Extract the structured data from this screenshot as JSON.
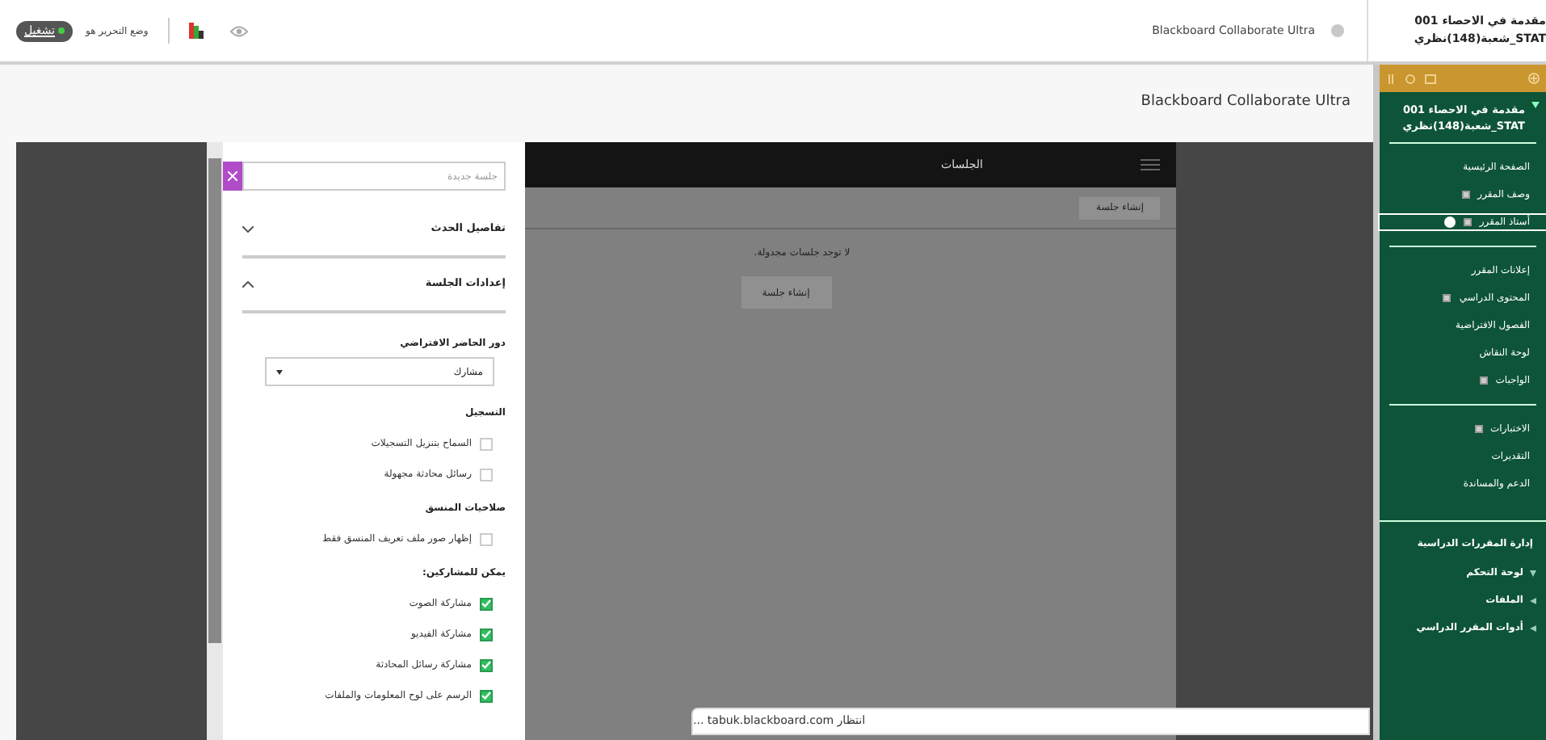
{
  "top_bar": {
    "edit_mode_label": "وضع التحرير هو",
    "edit_mode_toggle": {
      "label": "تشغيل",
      "on": true
    },
    "tool_name": "Blackboard Collaborate Ultra",
    "course_title": [
      "مقدمة في الاحصاء 001",
      "STAT_شعبة(148)نظري"
    ]
  },
  "page_title": "Blackboard Collaborate Ultra",
  "session_panel": {
    "search": {
      "placeholder": "جلسة جديدة"
    },
    "sections": [
      {
        "title": "تفاصيل الحدث",
        "expanded": false
      },
      {
        "title": "إعدادات الجلسة",
        "expanded": true
      }
    ],
    "role_label": "دور الحاضر الافتراضي",
    "role_value": "مشارك",
    "groups": [
      {
        "title": "التسجيل",
        "options": [
          {
            "label": "السماح بتنزيل التسجيلات",
            "checked": false
          },
          {
            "label": "رسائل محادثة مجهولة",
            "checked": false
          }
        ]
      },
      {
        "title": "صلاحيات المنسق",
        "options": [
          {
            "label": "إظهار صور ملف تعريف المنسق فقط",
            "checked": false
          }
        ]
      },
      {
        "title": "يمكن للمشاركين:",
        "options": [
          {
            "label": "مشاركة الصوت",
            "checked": true
          },
          {
            "label": "مشاركة الفيديو",
            "checked": true
          },
          {
            "label": "مشاركة رسائل المحادثة",
            "checked": true
          },
          {
            "label": "الرسم على لوح المعلومات والملفات",
            "checked": true
          }
        ]
      }
    ]
  },
  "sessions": {
    "header": "الجلسات",
    "toolbar_button": "إنشاء جلسة",
    "empty_message": "لا توجد جلسات مجدولة.",
    "create_button": "إنشاء جلسة"
  },
  "course_menu": {
    "title": [
      "مقدمة في الاحصاء 001",
      "STAT_شعبة(148)نظري"
    ],
    "expanded": true,
    "sections": [
      {
        "items": [
          {
            "label": "الصفحة الرئيسية",
            "icon": false,
            "selected": false
          },
          {
            "label": "وصف المقرر",
            "icon": true,
            "selected": false
          },
          {
            "label": "أستاذ المقرر",
            "icon": true,
            "selected": true
          }
        ]
      },
      {
        "items": [
          {
            "label": "إعلانات المقرر",
            "icon": false,
            "selected": false
          },
          {
            "label": "المحتوى الدراسي",
            "icon": true,
            "selected": false
          },
          {
            "label": "الفصول الافتراضية",
            "icon": false,
            "selected": false
          },
          {
            "label": "لوحة النقاش",
            "icon": false,
            "selected": false
          },
          {
            "label": "الواجبات",
            "icon": true,
            "selected": false
          }
        ]
      },
      {
        "items": [
          {
            "label": "الاختبارات",
            "icon": true,
            "selected": false
          },
          {
            "label": "التقديرات",
            "icon": false,
            "selected": false
          },
          {
            "label": "الدعم والمساندة",
            "icon": false,
            "selected": false
          }
        ]
      }
    ]
  },
  "management": {
    "title": "إدارة المقررات الدراسية",
    "items": [
      {
        "label": "لوحة التحكم",
        "expanded": true
      },
      {
        "label": "الملفات",
        "expanded": false
      },
      {
        "label": "أدوات المقرر الدراسي",
        "expanded": false
      }
    ]
  },
  "status_bar": "انتظار tabuk.blackboard.com ..."
}
